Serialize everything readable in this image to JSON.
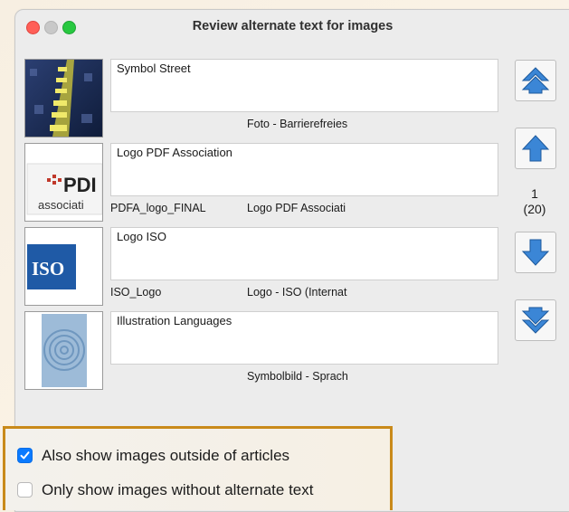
{
  "window": {
    "title": "Review alternate text for images"
  },
  "rows": [
    {
      "alt_text": "Symbol Street",
      "file_name": "",
      "caption": "Foto - Barrierefreies",
      "thumb": "street-photo"
    },
    {
      "alt_text": "Logo PDF Association",
      "file_name": "PDFA_logo_FINAL",
      "caption": "Logo PDF Associati",
      "thumb": "pdf-association-logo",
      "logo_text_1": "PDI",
      "logo_text_2": "associati"
    },
    {
      "alt_text": "Logo ISO",
      "file_name": "ISO_Logo",
      "caption": "Logo - ISO (Internat",
      "thumb": "iso-logo",
      "logo_text": "ISO"
    },
    {
      "alt_text": "Illustration Languages",
      "file_name": "",
      "caption": "Symbolbild - Sprach",
      "thumb": "spiral-illustration"
    }
  ],
  "navigation": {
    "first_icon": "double-arrow-up-icon",
    "prev_icon": "arrow-up-icon",
    "next_icon": "arrow-down-icon",
    "last_icon": "double-arrow-down-icon",
    "current": "1",
    "total": "(20)"
  },
  "options": {
    "outside_articles": {
      "label": "Also show images outside of articles",
      "checked": true
    },
    "without_alt": {
      "label": "Only show images without alternate text",
      "checked": false
    }
  },
  "colors": {
    "accent": "#0a7aff",
    "arrow": "#3b86d6",
    "highlight_frame": "#c98a1a"
  }
}
